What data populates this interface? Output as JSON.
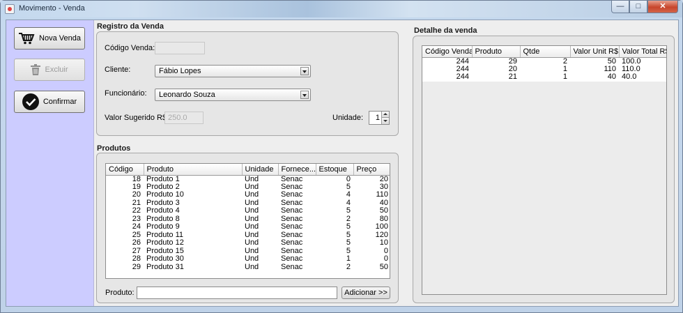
{
  "window": {
    "title": "Movimento - Venda"
  },
  "left_actions": {
    "nova_venda": "Nova Venda",
    "excluir": "Excluir",
    "confirmar": "Confirmar"
  },
  "registro": {
    "title": "Registro da Venda",
    "codigo_label": "Código Venda:",
    "codigo_value": "",
    "cliente_label": "Cliente:",
    "cliente_value": "Fábio Lopes",
    "funcionario_label": "Funcionário:",
    "funcionario_value": "Leonardo Souza",
    "valor_label": "Valor Sugerido R$:",
    "valor_value": "250.0",
    "unidade_label": "Unidade:",
    "unidade_value": "1"
  },
  "produtos": {
    "title": "Produtos",
    "columns": [
      "Código",
      "Produto",
      "Unidade",
      "Fornece...",
      "Estoque",
      "Preço"
    ],
    "rows": [
      [
        "18",
        "Produto 1",
        "Und",
        "Senac",
        "0",
        "20"
      ],
      [
        "19",
        "Produto 2",
        "Und",
        "Senac",
        "5",
        "30"
      ],
      [
        "20",
        "Produto 10",
        "Und",
        "Senac",
        "4",
        "110"
      ],
      [
        "21",
        "Produto 3",
        "Und",
        "Senac",
        "4",
        "40"
      ],
      [
        "22",
        "Produto 4",
        "Und",
        "Senac",
        "5",
        "50"
      ],
      [
        "23",
        "Produto 8",
        "Und",
        "Senac",
        "2",
        "80"
      ],
      [
        "24",
        "Produto 9",
        "Und",
        "Senac",
        "5",
        "100"
      ],
      [
        "25",
        "Produto 11",
        "Und",
        "Senac",
        "5",
        "120"
      ],
      [
        "26",
        "Produto 12",
        "Und",
        "Senac",
        "5",
        "10"
      ],
      [
        "27",
        "Produto 15",
        "Und",
        "Senac",
        "5",
        "0"
      ],
      [
        "28",
        "Produto 30",
        "Und",
        "Senac",
        "1",
        "0"
      ],
      [
        "29",
        "Produto 31",
        "Und",
        "Senac",
        "2",
        "50"
      ]
    ],
    "search_label": "Produto:",
    "search_value": "",
    "add_button": "Adicionar >>"
  },
  "detalhe": {
    "title": "Detalhe da venda",
    "columns": [
      "Código Venda",
      "Produto",
      "Qtde",
      "Valor Unit R$",
      "Valor Total R$"
    ],
    "rows": [
      [
        "244",
        "29",
        "2",
        "50",
        "100.0"
      ],
      [
        "244",
        "20",
        "1",
        "110",
        "110.0"
      ],
      [
        "244",
        "21",
        "1",
        "40",
        "40.0"
      ]
    ]
  },
  "colors": {
    "left_pane": "#ccccff",
    "panel": "#e6e6e6",
    "window_frame": "#bfd2e8"
  }
}
